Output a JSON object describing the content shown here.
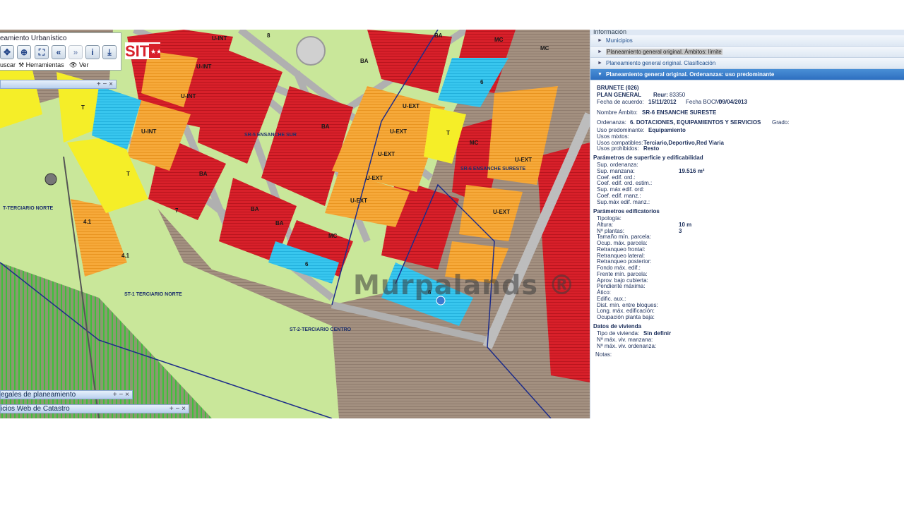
{
  "toolbar": {
    "title": "eamiento Urbanístico",
    "buscar_label": "uscar",
    "herramientas_label": "Herramientas",
    "ver_label": "Ver",
    "logo_text": "SIT"
  },
  "panels": {
    "legales": "egales de planeamiento",
    "catastro": "icios Web de Catastro",
    "controls": "+ − ×"
  },
  "map": {
    "watermark": "Murpalands ®",
    "zone_labels": [
      "U-INT",
      "U-INT",
      "U-INT",
      "U-INT",
      "BA",
      "BA",
      "BA",
      "BA",
      "BA",
      "BA",
      "MC",
      "MC",
      "MC",
      "MC",
      "U-EXT",
      "U-EXT",
      "U-EXT",
      "U-EXT",
      "U-EXT",
      "U-EXT",
      "U-EXT",
      "T",
      "T",
      "T",
      "6",
      "6",
      "6",
      "4.1",
      "4.1",
      "7",
      "8"
    ],
    "area_names": [
      "SR-5 ENSANCHE SUR",
      "SR-6 ENSANCHE SURESTE",
      "ST-1 TERCIARIO NORTE",
      "ST-2-TERCIARIO CENTRO",
      "T-TERCIARIO NORTE"
    ]
  },
  "info": {
    "header": "Información",
    "sections": [
      {
        "label": "Municipios"
      },
      {
        "label": "Planeamiento general original. Ámbitos: límite"
      },
      {
        "label": "Planeamiento general original. Clasificación"
      },
      {
        "label": "Planeamiento general original. Ordenanzas: uso predominante"
      }
    ],
    "municipio": "BRUNETE (026)",
    "plan": "PLAN GENERAL",
    "reur_label": "Reur:",
    "reur": "83350",
    "fecha_acuerdo_label": "Fecha de acuerdo:",
    "fecha_acuerdo": "15/11/2012",
    "fecha_bocm_label": "Fecha BOCM:",
    "fecha_bocm": "09/04/2013",
    "ambito_label": "Nombre Ámbito:",
    "ambito": "SR-6 ENSANCHE SURESTE",
    "ordenanza_label": "Ordenanza:",
    "ordenanza": "6. DOTACIONES, EQUIPAMIENTOS Y SERVICIOS",
    "grado_label": "Grado:",
    "uso_pred_label": "Uso predominante:",
    "uso_pred": "Equipamiento",
    "usos_mixtos_label": "Usos mixtos:",
    "usos_compat_label": "Usos compatibles:",
    "usos_compat": "Terciario,Deportivo,Red Viaria",
    "usos_prohib_label": "Usos prohibidos:",
    "usos_prohib": "Resto",
    "sup_header": "Parámetros de superficie y edificabilidad",
    "sup_rows": [
      {
        "label": "Sup. ordenanza:",
        "value": ""
      },
      {
        "label": "Sup. manzana:",
        "value": "19.516 m²"
      },
      {
        "label": "Coef. edif. ord.:",
        "value": ""
      },
      {
        "label": "Coef. edif. ord. estim.:",
        "value": ""
      },
      {
        "label": "Sup. máx edif. ord:",
        "value": ""
      },
      {
        "label": "Coef. edif. manz.:",
        "value": ""
      },
      {
        "label": "Sup.máx edif. manz.:",
        "value": ""
      }
    ],
    "edif_header": "Parámetros edificatorios",
    "edif_rows": [
      {
        "label": "Tipología:",
        "value": ""
      },
      {
        "label": "Altura:",
        "value": "10 m"
      },
      {
        "label": "Nº plantas:",
        "value": "3"
      },
      {
        "label": "Tamaño mín. parcela:",
        "value": ""
      },
      {
        "label": "Ocup. máx. parcela:",
        "value": ""
      },
      {
        "label": "Retranqueo frontal:",
        "value": ""
      },
      {
        "label": "Retranqueo lateral:",
        "value": ""
      },
      {
        "label": "Retranqueo posterior:",
        "value": ""
      },
      {
        "label": "Fondo máx. edif.:",
        "value": ""
      },
      {
        "label": "Frente mín. parcela:",
        "value": ""
      },
      {
        "label": "Aprov. bajo cubierta:",
        "value": ""
      },
      {
        "label": "Pendiente máxima:",
        "value": ""
      },
      {
        "label": "Ático:",
        "value": ""
      },
      {
        "label": "Edific. aux.:",
        "value": ""
      },
      {
        "label": "Dist. mín. entre bloques:",
        "value": ""
      },
      {
        "label": "Long. máx. edificación:",
        "value": ""
      },
      {
        "label": "Ocupación planta baja:",
        "value": ""
      }
    ],
    "viv_header": "Datos de vivienda",
    "tipo_viv_label": "Tipo de vivienda:",
    "tipo_viv": "Sin definir",
    "viv_manz_label": "Nº máx. viv. manzana:",
    "viv_ord_label": "Nº máx. viv. ordenanza:",
    "notas_label": "Notas:"
  }
}
